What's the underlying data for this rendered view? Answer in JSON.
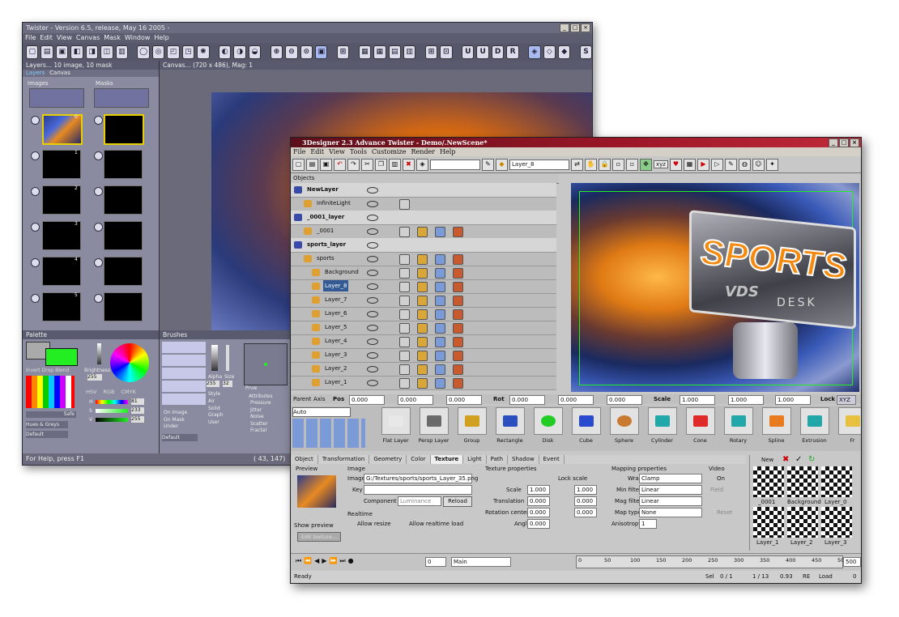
{
  "twister": {
    "title": "Twister - Version 6.5, release, May 16 2005 -",
    "menu": [
      "File",
      "Edit",
      "View",
      "Canvas",
      "Mask",
      "Window",
      "Help"
    ],
    "layers_panel_title": "Layers... 10 image, 10 mask",
    "canvas_panel_title": "Canvas... (720 x 486), Mag: 1",
    "layers_tabs": [
      "Layers",
      "Canvas"
    ],
    "images_group": "Images",
    "masks_group": "Masks",
    "slot_numbers": [
      "0",
      "1",
      "2",
      "3",
      "4",
      "5"
    ],
    "palette_title": "Palette",
    "brushes_title": "Brushes",
    "palette_buttons": [
      "Invert",
      "Drop",
      "Blend"
    ],
    "brightness_label": "Brightness",
    "brightness_value": "255",
    "color_tabs": [
      "HSV",
      "RGB",
      "CMYK"
    ],
    "hsv_labels": [
      "H",
      "S",
      "V"
    ],
    "hsv_values": [
      "81",
      "233",
      "255"
    ],
    "safe_label": "Safe",
    "hues_select": "Hues & Greys",
    "default_select": "Default",
    "alpha_label": "Alpha",
    "size_label": "Size",
    "alpha_value": "255",
    "size_value": "32",
    "prvw_label": "Prvw",
    "brush_default": "Default",
    "slot_options": [
      "On Image",
      "On Mask",
      "Under"
    ],
    "style_label": "Style",
    "style_options": [
      "Air",
      "Solid",
      "Graph",
      "User"
    ],
    "attributes_label": "Attributes",
    "attribute_items": [
      "Pressure",
      "Jitter",
      "Noise",
      "Scatter",
      "Fractal"
    ],
    "status_left": "For Help, press F1",
    "status_right": "( 43, 147)"
  },
  "designer": {
    "title": "3Designer 2.3 Advance Twister - Demo/.NewScene*",
    "menu": [
      "File",
      "Edit",
      "View",
      "Tools",
      "Customize",
      "Render",
      "Help"
    ],
    "layer_field": "Layer_8",
    "xyz_label": "xyz",
    "objects_header": "Objects",
    "rows": [
      {
        "name": "NewLayer",
        "type": "layer"
      },
      {
        "name": "InfiniteLight",
        "type": "item"
      },
      {
        "name": "_0001_layer",
        "type": "layer"
      },
      {
        "name": "_0001",
        "type": "item"
      },
      {
        "name": "sports_layer",
        "type": "layer"
      },
      {
        "name": "sports",
        "type": "item"
      },
      {
        "name": "Background",
        "type": "child"
      },
      {
        "name": "Layer_8",
        "type": "child",
        "selected": true
      },
      {
        "name": "Layer_7",
        "type": "child"
      },
      {
        "name": "Layer_6",
        "type": "child"
      },
      {
        "name": "Layer_5",
        "type": "child"
      },
      {
        "name": "Layer_4",
        "type": "child"
      },
      {
        "name": "Layer_3",
        "type": "child"
      },
      {
        "name": "Layer_2",
        "type": "child"
      },
      {
        "name": "Layer_1",
        "type": "child"
      }
    ],
    "viewport_text_sports": "SPORTS",
    "viewport_text_vds": "VDS",
    "viewport_text_desk": "DESK",
    "propbar": {
      "parent": "Parent",
      "axis": "Axis",
      "pos": "Pos",
      "rot": "Rot",
      "scale": "Scale",
      "lock": "Lock",
      "lock_value": "XYZ",
      "pos_values": [
        "0.000",
        "0.000",
        "0.000"
      ],
      "rot_values": [
        "0.000",
        "0.000",
        "0.000"
      ],
      "scale_values": [
        "1.000",
        "1.000",
        "1.000"
      ]
    },
    "auto_select": "Auto",
    "primitives": [
      "Flat Layer",
      "Persp Layer",
      "Group",
      "Rectangle",
      "Disk",
      "Cube",
      "Sphere",
      "Cylinder",
      "Cone",
      "Rotary",
      "Spline",
      "Extrusion",
      "Fr"
    ],
    "tabs": [
      "Object",
      "Transformation",
      "Geometry",
      "Color",
      "Texture",
      "Light",
      "Path",
      "Shadow",
      "Event"
    ],
    "active_tab": "Texture",
    "texture": {
      "preview_label": "Preview",
      "image_group": "Image",
      "image_label": "Image",
      "image_path": "G:/Textures/sports/sports_Layer_35.png",
      "key_label": "Key",
      "component_label": "Component as",
      "component_value": "Luminance",
      "reload": "Reload",
      "realtime_group": "Realtime",
      "allow_resize": "Allow resize",
      "allow_realtime": "Allow realtime load",
      "show_preview": "Show preview",
      "edit_texture": "Edit texture...",
      "texprops_group": "Texture properties",
      "lock_scale": "Lock scale",
      "scale_label": "Scale",
      "translation_label": "Translation",
      "rotcenter_label": "Rotation center",
      "angle_label": "Angle",
      "scale_x": "1.000",
      "scale_y": "1.000",
      "trans_x": "0.000",
      "trans_y": "0.000",
      "rotc_x": "0.000",
      "rotc_y": "0.000",
      "angle_value": "0.000",
      "mapping_group": "Mapping properties",
      "wrap_label": "Wrap",
      "wrap_value": "Clamp",
      "minf_label": "Min filter",
      "minf_value": "Linear",
      "magf_label": "Mag filter",
      "magf_value": "Linear",
      "maptype_label": "Map type",
      "maptype_value": "None",
      "aniso_label": "Anisotropy",
      "aniso_value": "1",
      "video_group": "Video",
      "on_label": "On",
      "field_label": "Field",
      "reset_label": "Reset"
    },
    "thumbs": {
      "new_label": "New",
      "names": [
        "_0001",
        "Background",
        "Layer_0",
        "Layer_1",
        "Layer_2",
        "Layer_3"
      ]
    },
    "timeline": {
      "frame_value": "0",
      "scene_select": "Main",
      "ticks": [
        "0",
        "50",
        "100",
        "150",
        "200",
        "250",
        "300",
        "350",
        "400",
        "450",
        "500"
      ],
      "end_value": "500"
    },
    "status": {
      "left": "Ready",
      "sel": "Sel",
      "sel_value": "0 / 1",
      "frame": "1 / 13",
      "fps": "0.93",
      "re": "RE",
      "load": "Load",
      "count": "0"
    }
  },
  "colors": {
    "twister_bg": "#7a7a8c",
    "designer_title": "#9d1728",
    "selection": "#345a94",
    "palette_green": "#22ee22",
    "orange": "#e88a22"
  }
}
